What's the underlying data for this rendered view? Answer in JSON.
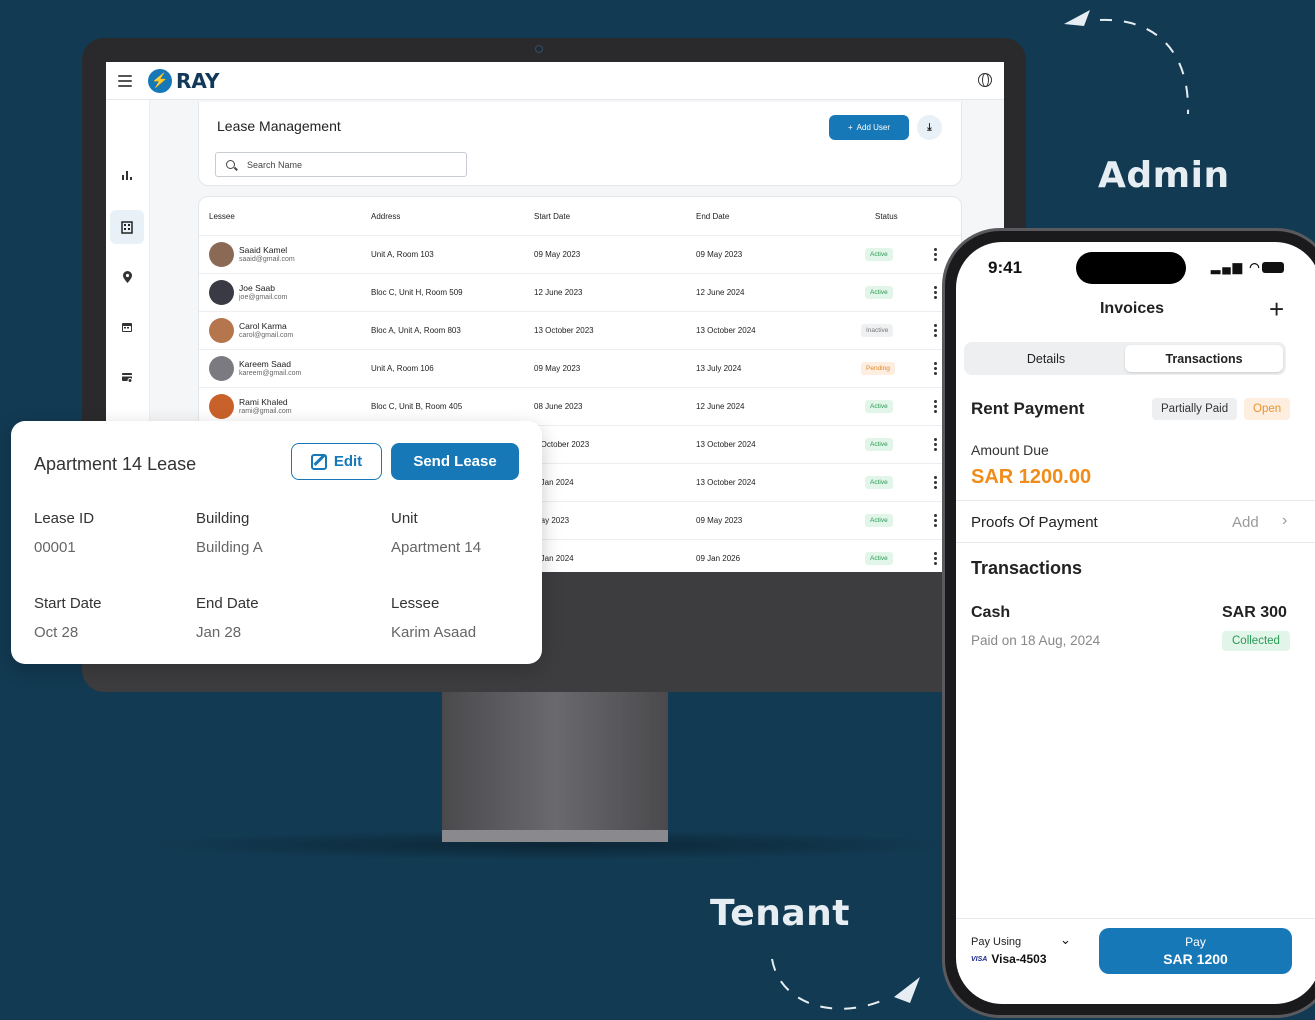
{
  "labels": {
    "admin": "Admin",
    "tenant": "Tenant"
  },
  "desktop": {
    "brand": "RAY",
    "page_title": "Lease Management",
    "search_placeholder": "Search Name",
    "add_user_label": "Add User",
    "columns": [
      "Lessee",
      "Address",
      "Start Date",
      "End Date",
      "Status"
    ],
    "rows": [
      {
        "name": "Saaid Kamel",
        "email": "saaid@gmail.com",
        "address": "Unit A, Room 103",
        "start": "09 May 2023",
        "end": "09 May 2023",
        "status": "Active"
      },
      {
        "name": "Joe Saab",
        "email": "joe@gmail.com",
        "address": "Bloc C, Unit H, Room 509",
        "start": "12 June 2023",
        "end": "12 June 2024",
        "status": "Active"
      },
      {
        "name": "Carol Karma",
        "email": "carol@gmail.com",
        "address": "Bloc A, Unit A, Room 803",
        "start": "13 October 2023",
        "end": "13 October 2024",
        "status": "Inactive"
      },
      {
        "name": "Kareem Saad",
        "email": "kareem@gmail.com",
        "address": "Unit A, Room 106",
        "start": "09 May 2023",
        "end": "13 July 2024",
        "status": "Pending"
      },
      {
        "name": "Rami Khaled",
        "email": "rami@gmail.com",
        "address": "Bloc C, Unit B, Room 405",
        "start": "08 June 2023",
        "end": "12 June 2024",
        "status": "Active"
      },
      {
        "name": "",
        "email": "",
        "address": "",
        "start": "3 October 2023",
        "end": "13 October 2024",
        "status": "Active"
      },
      {
        "name": "",
        "email": "",
        "address": "",
        "start": "3 Jan 2024",
        "end": "13 October 2024",
        "status": "Active"
      },
      {
        "name": "",
        "email": "",
        "address": "",
        "start": "May 2023",
        "end": "09 May 2023",
        "status": "Active"
      },
      {
        "name": "",
        "email": "",
        "address": "",
        "start": "9 Jan 2024",
        "end": "09 Jan 2026",
        "status": "Active"
      }
    ]
  },
  "lease_card": {
    "title": "Apartment 14 Lease",
    "edit_label": "Edit",
    "send_label": "Send Lease",
    "fields": [
      {
        "label": "Lease ID",
        "value": "00001"
      },
      {
        "label": "Building",
        "value": "Building A"
      },
      {
        "label": "Unit",
        "value": "Apartment 14"
      },
      {
        "label": "Start Date",
        "value": "Oct 28"
      },
      {
        "label": "End Date",
        "value": "Jan 28"
      },
      {
        "label": "Lessee",
        "value": "Karim Asaad"
      }
    ]
  },
  "phone": {
    "time": "9:41",
    "title": "Invoices",
    "tabs": [
      "Details",
      "Transactions"
    ],
    "selected_tab": "Transactions",
    "rent_title": "Rent Payment",
    "chip_partial": "Partially Paid",
    "chip_open": "Open",
    "amount_label": "Amount Due",
    "amount_value": "SAR 1200.00",
    "proofs_label": "Proofs Of Payment",
    "proofs_add": "Add",
    "transactions_title": "Transactions",
    "cash_label": "Cash",
    "cash_amount": "SAR 300",
    "paid_on": "Paid on 18 Aug, 2024",
    "collected": "Collected",
    "pay_using": "Pay Using",
    "card": "Visa-4503",
    "visa_logo": "VISA",
    "pay_label": "Pay",
    "pay_amount": "SAR 1200"
  },
  "colors": {
    "accent": "#1778b8",
    "background": "#123a52",
    "amount": "#f08c1a"
  }
}
